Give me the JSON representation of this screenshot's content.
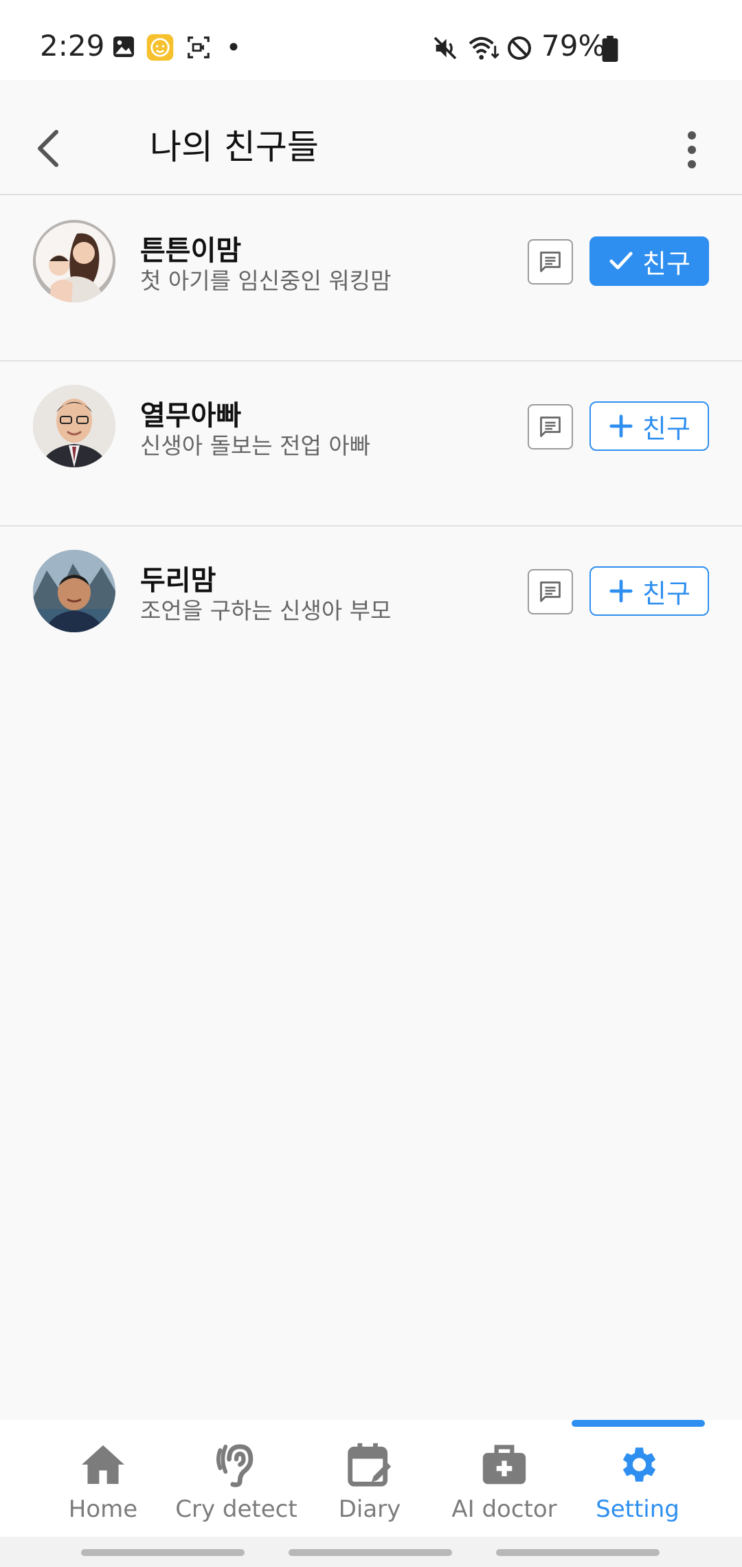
{
  "status_bar": {
    "time": "2:29",
    "battery": "79%",
    "icons": [
      "gallery-icon",
      "baby-app-icon",
      "screen-record-icon",
      "notification-dot-icon",
      "mute-icon",
      "wifi-icon",
      "do-not-disturb-icon",
      "battery-icon"
    ]
  },
  "app_bar": {
    "title": "나의 친구들",
    "back_icon": "chevron-left-icon",
    "more_icon": "more-vert-icon"
  },
  "friends": [
    {
      "name": "튼튼이맘",
      "description": "첫 아기를 임신중인 워킹맘",
      "button_label": "친구",
      "status": "added"
    },
    {
      "name": "열무아빠",
      "description": "신생아 돌보는 전업 아빠",
      "button_label": "친구",
      "status": "not-added"
    },
    {
      "name": "두리맘",
      "description": "조언을 구하는 신생아 부모",
      "button_label": "친구",
      "status": "not-added"
    }
  ],
  "bottom_nav": {
    "items": [
      {
        "label": "Home",
        "icon": "home-icon"
      },
      {
        "label": "Cry detect",
        "icon": "ear-icon"
      },
      {
        "label": "Diary",
        "icon": "calendar-edit-icon"
      },
      {
        "label": "AI doctor",
        "icon": "medical-bag-icon"
      },
      {
        "label": "Setting",
        "icon": "gear-icon",
        "active": true
      }
    ]
  },
  "colors": {
    "accent": "#2e8ff0",
    "background": "#f9f9f9",
    "inactive_nav": "#7c7c7c"
  }
}
